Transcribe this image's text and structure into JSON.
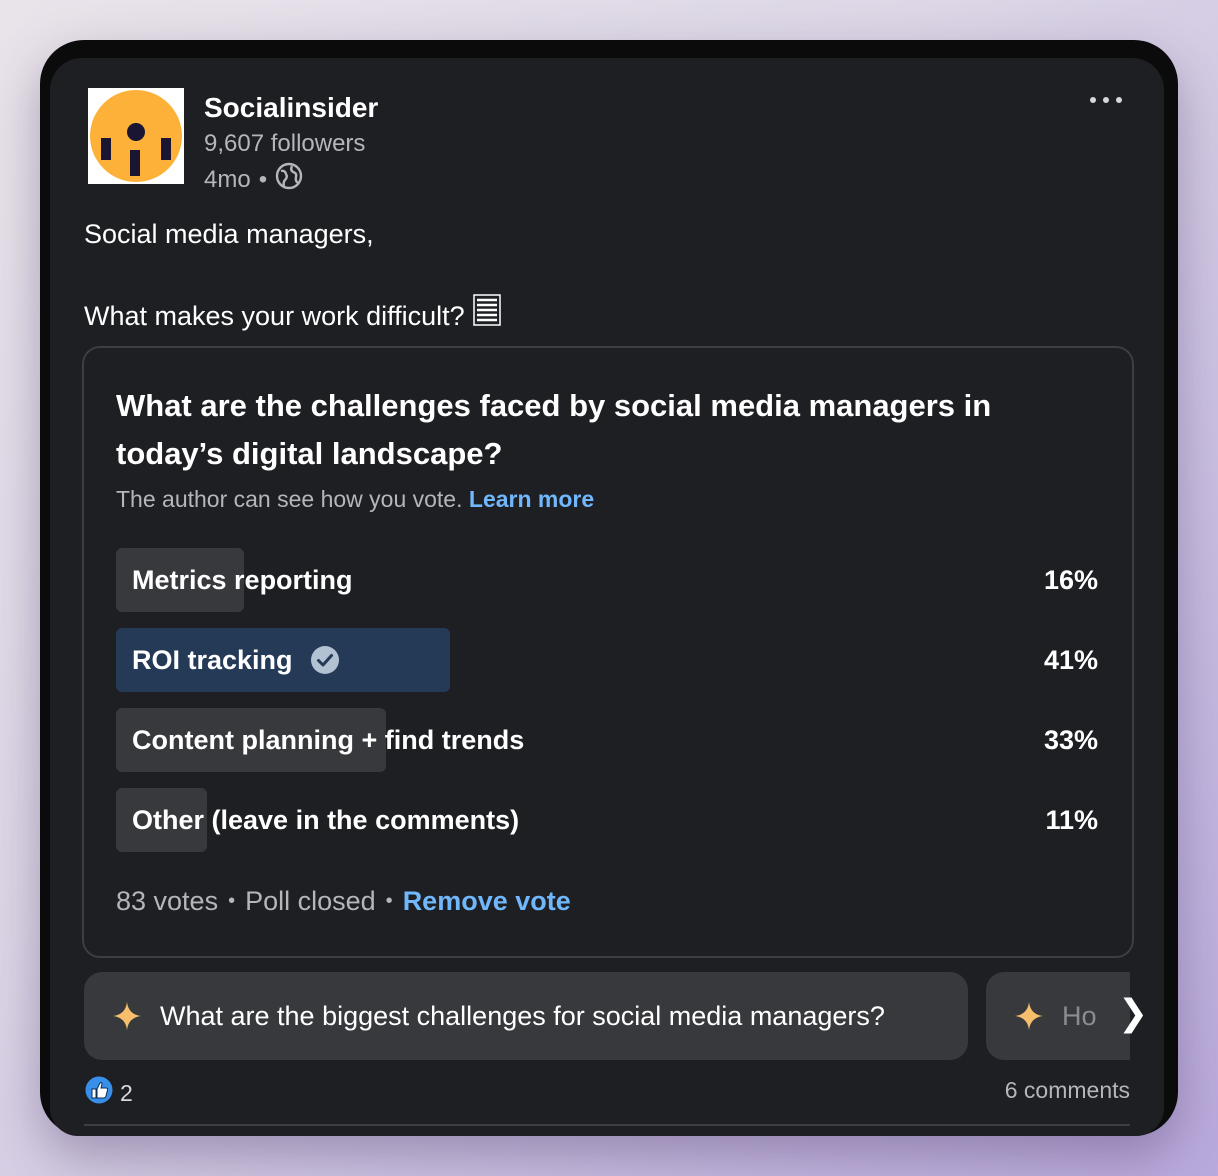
{
  "author": {
    "name": "Socialinsider",
    "followers": "9,607 followers",
    "time": "4mo",
    "separator": "•",
    "logo_colors": {
      "circle": "#fdb138",
      "marks": "#1a1533"
    }
  },
  "post": {
    "line1": "Social media managers,",
    "line2": "What makes your work difficult?",
    "line2_emoji": "memo-icon"
  },
  "poll": {
    "question": "What are the challenges faced by social media managers in today’s digital landscape?",
    "note": "The author can see how you vote.",
    "learn_more": "Learn more",
    "options": [
      {
        "label": "Metrics reporting",
        "percent": "16%",
        "fraction": 0.13,
        "selected": false
      },
      {
        "label": "ROI tracking",
        "percent": "41%",
        "fraction": 0.34,
        "selected": true
      },
      {
        "label": "Content planning + find trends",
        "percent": "33%",
        "fraction": 0.275,
        "selected": false
      },
      {
        "label": "Other (leave in the comments)",
        "percent": "11%",
        "fraction": 0.093,
        "selected": false
      }
    ],
    "votes": "83 votes",
    "status": "Poll closed",
    "remove_vote": "Remove vote",
    "dot": "•"
  },
  "suggestions": [
    {
      "text": "What are the biggest challenges for social media managers?",
      "icon": "sparkle-icon"
    },
    {
      "text": "Ho",
      "icon": "sparkle-icon"
    }
  ],
  "chevron": "❯",
  "footer": {
    "reaction_count": "2",
    "comments": "6 comments"
  },
  "colors": {
    "background": "#1d1f23",
    "link": "#71b7fb",
    "selected_fill": "#243a56",
    "option_fill": "#38393d"
  }
}
